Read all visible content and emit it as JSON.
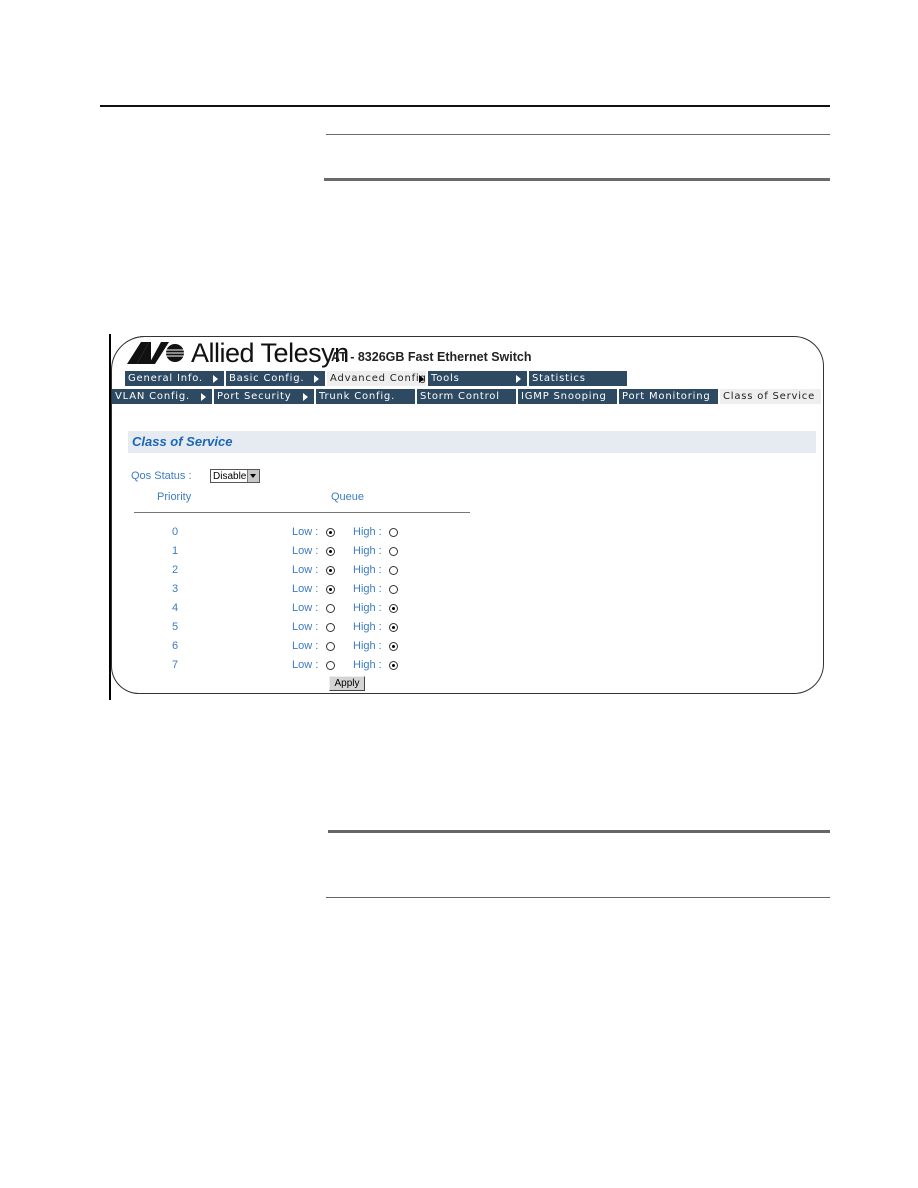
{
  "app": {
    "brand": "Allied Telesyn",
    "product": "AT - 8326GB Fast Ethernet Switch"
  },
  "menu_primary": [
    {
      "label": "General Info.",
      "has_submenu": true,
      "active": false
    },
    {
      "label": "Basic Config.",
      "has_submenu": true,
      "active": false
    },
    {
      "label": "Advanced Config.",
      "has_submenu": true,
      "active": true
    },
    {
      "label": "Tools",
      "has_submenu": true,
      "active": false
    },
    {
      "label": "Statistics",
      "has_submenu": false,
      "active": false
    }
  ],
  "menu_secondary": [
    {
      "label": "VLAN Config.",
      "has_submenu": true,
      "active": false
    },
    {
      "label": "Port Security",
      "has_submenu": true,
      "active": false
    },
    {
      "label": "Trunk Config.",
      "has_submenu": false,
      "active": false
    },
    {
      "label": "Storm Control",
      "has_submenu": false,
      "active": false
    },
    {
      "label": "IGMP Snooping",
      "has_submenu": false,
      "active": false
    },
    {
      "label": "Port Monitoring",
      "has_submenu": false,
      "active": false
    },
    {
      "label": "Class of Service",
      "has_submenu": false,
      "active": true
    }
  ],
  "page": {
    "title": "Class of Service",
    "qos_status_label": "Qos Status :",
    "qos_status_value": "Disable",
    "col_priority": "Priority",
    "col_queue": "Queue",
    "low_label": "Low :",
    "high_label": "High :",
    "apply_label": "Apply"
  },
  "rows": [
    {
      "priority": "0",
      "queue": "low"
    },
    {
      "priority": "1",
      "queue": "low"
    },
    {
      "priority": "2",
      "queue": "low"
    },
    {
      "priority": "3",
      "queue": "low"
    },
    {
      "priority": "4",
      "queue": "high"
    },
    {
      "priority": "5",
      "queue": "high"
    },
    {
      "priority": "6",
      "queue": "high"
    },
    {
      "priority": "7",
      "queue": "high"
    }
  ],
  "colors": {
    "menu_bg": "#2d4a62",
    "menu_active_bg": "#eeeeee",
    "title_blue": "#1a67b8",
    "label_blue": "#3b7cc2",
    "section_bg": "#e6ebf2"
  }
}
